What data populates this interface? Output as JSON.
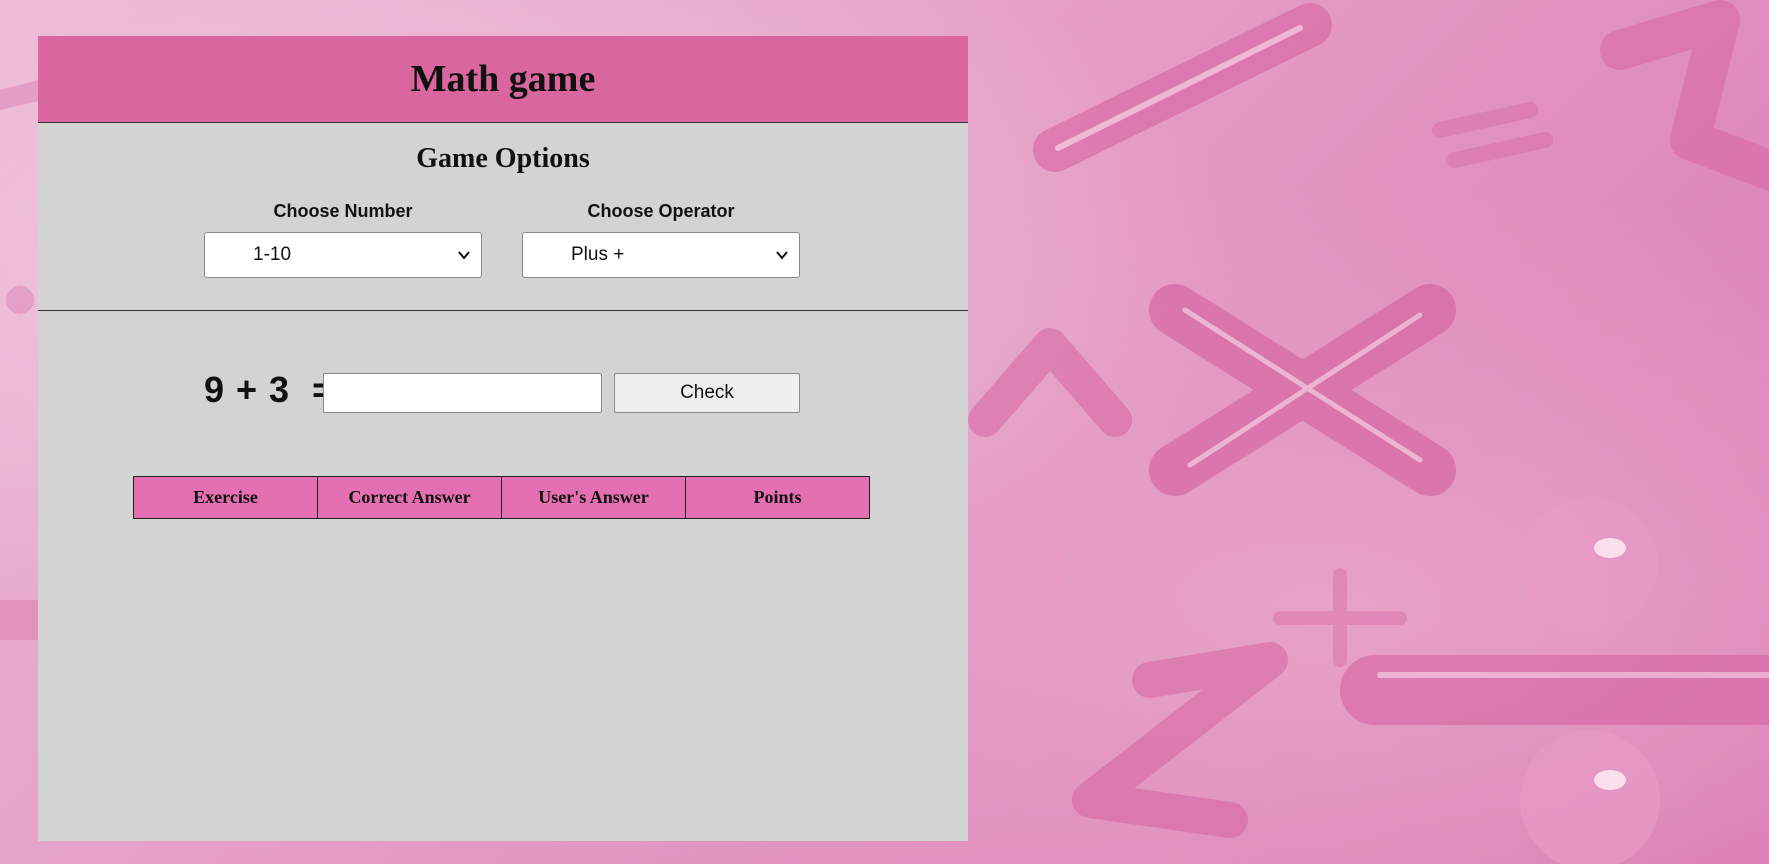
{
  "header": {
    "title": "Math game"
  },
  "options": {
    "title": "Game Options",
    "number": {
      "label": "Choose Number",
      "selected": "1-10"
    },
    "operator": {
      "label": "Choose Operator",
      "selected": "Plus +"
    }
  },
  "game": {
    "exercise": "9 + 3  =",
    "answer_value": "",
    "check_label": "Check"
  },
  "results": {
    "columns": [
      "Exercise",
      "Correct Answer",
      "User's Answer",
      "Points"
    ]
  },
  "colors": {
    "header_bg": "#d9669f",
    "panel_bg": "#d3d3d3",
    "table_header_bg": "#e46fb1"
  }
}
